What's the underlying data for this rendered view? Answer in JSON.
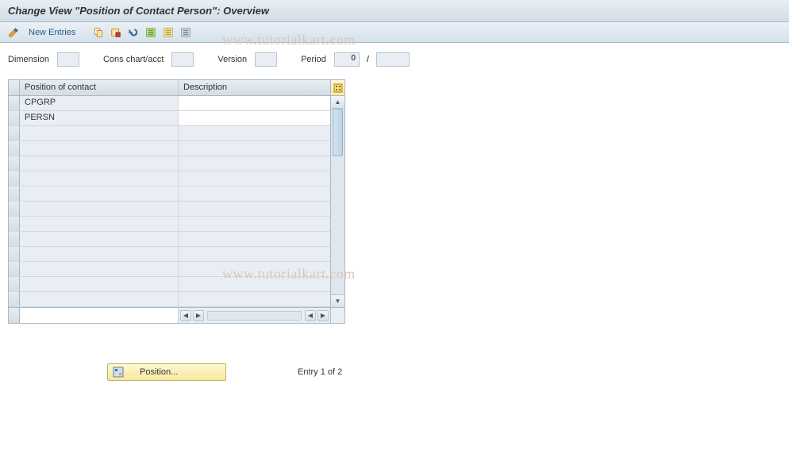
{
  "title": "Change View \"Position of Contact Person\": Overview",
  "toolbar": {
    "new_entries_label": "New Entries"
  },
  "filters": {
    "dimension_label": "Dimension",
    "cons_label": "Cons chart/acct",
    "version_label": "Version",
    "period_label": "Period",
    "period_value": "0",
    "period_sep": "/"
  },
  "table": {
    "col1_header": "Position of contact",
    "col2_header": "Description",
    "rows": [
      {
        "position": "CPGRP",
        "description": ""
      },
      {
        "position": "PERSN",
        "description": ""
      }
    ],
    "empty_row_count": 12
  },
  "footer": {
    "position_button": "Position...",
    "entry_text": "Entry 1 of 2"
  },
  "watermark": "www.tutorialkart.com"
}
